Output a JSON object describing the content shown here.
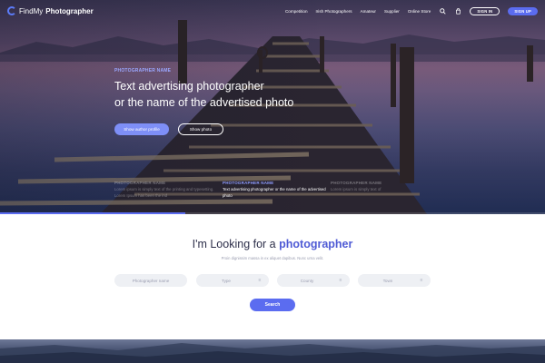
{
  "brand": {
    "prefix": "FindMy",
    "suffix": "Photographer"
  },
  "nav": {
    "items": [
      "Competition",
      "Irish Photographers",
      "Amateur",
      "Supplier",
      "Online Store"
    ],
    "signin": "SIGN IN",
    "signup": "SIGN UP"
  },
  "hero": {
    "eyebrow": "PHOTOGRAPHER NAME",
    "headline_line1": "Text advertising photographer",
    "headline_line2": "or the name of the advertised photo",
    "primary_button": "Show author profile",
    "secondary_button": "Show photo",
    "slides": [
      {
        "title": "PHOTOGRAPHER NAME",
        "desc": "Lorem ipsum is simply text of the printing and typesetting. Lorem Ipsum has been the ind"
      },
      {
        "title": "PHOTOGRAPHER NAME",
        "desc": "Text advertising photographer or the name of the advertised photo"
      },
      {
        "title": "PHOTOGRAPHER NAME",
        "desc": "Lorem ipsum is simply text of"
      }
    ],
    "progress_fraction": 0.34
  },
  "finder": {
    "title_plain": "I'm Looking for a",
    "title_accent": "photographer",
    "subtitle": "Proin dignissim massa in ex aliquet dapibus. Nunc urna velit.",
    "name_placeholder": "Photographer name",
    "type_label": "Type",
    "county_label": "County",
    "town_label": "Town",
    "search_button": "Search"
  },
  "colors": {
    "accent": "#5b6cf0",
    "title": "#2d2f4a",
    "field_bg": "#eef0f4"
  }
}
